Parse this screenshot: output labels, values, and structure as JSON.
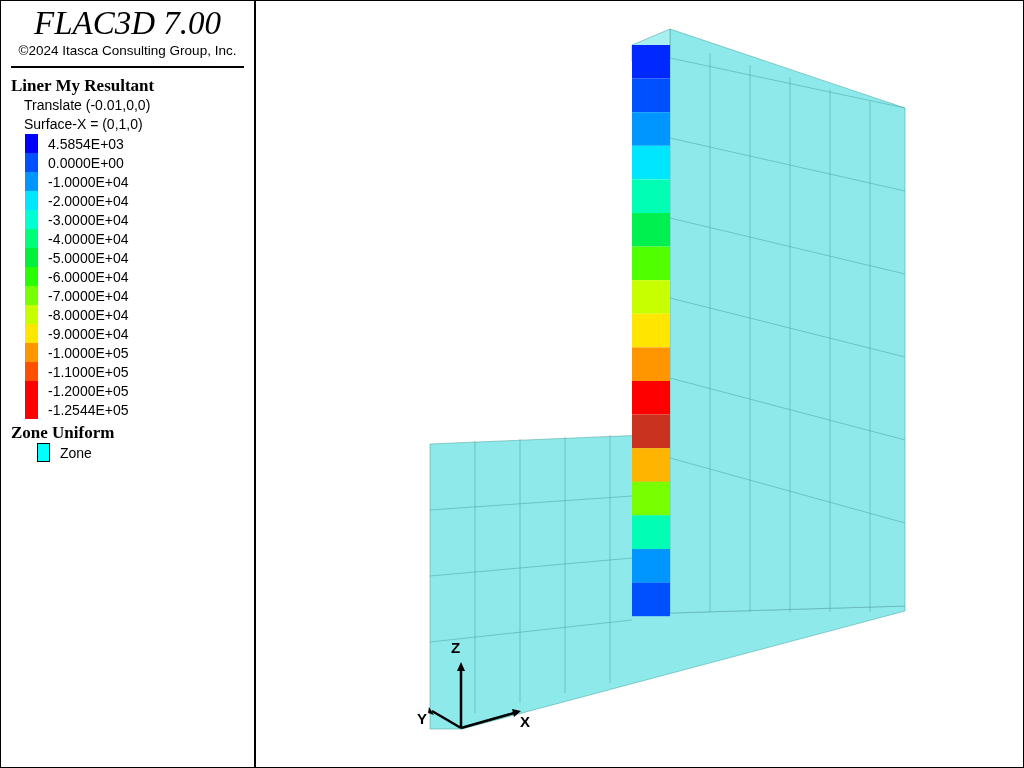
{
  "header": {
    "title": "FLAC3D 7.00",
    "copyright": "©2024 Itasca Consulting Group, Inc."
  },
  "legend": {
    "title": "Liner My Resultant",
    "notes": [
      "Translate (-0.01,0,0)",
      "Surface-X = (0,1,0)"
    ],
    "items": [
      {
        "label": "4.5854E+03",
        "color": "#0000ff"
      },
      {
        "label": "0.0000E+00",
        "color": "#0050ff"
      },
      {
        "label": "-1.0000E+04",
        "color": "#0096ff"
      },
      {
        "label": "-2.0000E+04",
        "color": "#00e6ff"
      },
      {
        "label": "-3.0000E+04",
        "color": "#00ffd2"
      },
      {
        "label": "-4.0000E+04",
        "color": "#00ff78"
      },
      {
        "label": "-5.0000E+04",
        "color": "#00f03c"
      },
      {
        "label": "-6.0000E+04",
        "color": "#28ff00"
      },
      {
        "label": "-7.0000E+04",
        "color": "#78ff00"
      },
      {
        "label": "-8.0000E+04",
        "color": "#c8ff00"
      },
      {
        "label": "-9.0000E+04",
        "color": "#ffe600"
      },
      {
        "label": "-1.0000E+05",
        "color": "#ff9600"
      },
      {
        "label": "-1.1000E+05",
        "color": "#ff5000"
      },
      {
        "label": "-1.2000E+05",
        "color": "#ff0000"
      },
      {
        "label": "-1.2544E+05",
        "color": "#ff0000"
      }
    ],
    "zone_title": "Zone Uniform",
    "zone_items": [
      {
        "label": "Zone",
        "color": "#00ffff"
      }
    ]
  },
  "axes": {
    "z": "Z",
    "x": "X",
    "y": "Y"
  }
}
